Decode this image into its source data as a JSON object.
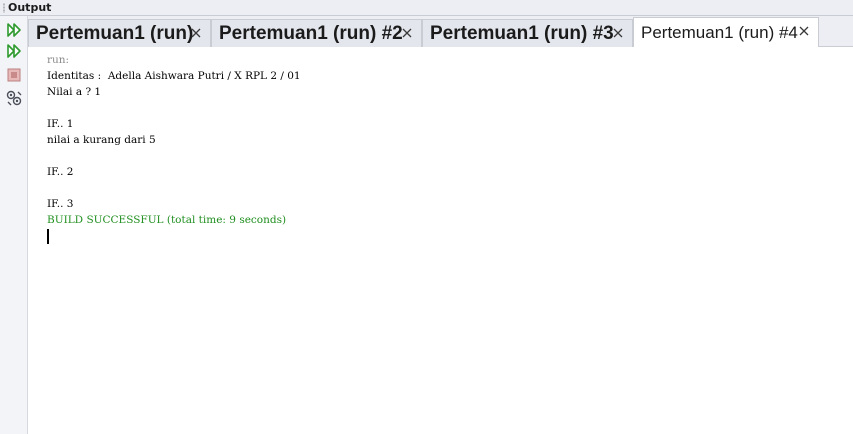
{
  "window": {
    "title": "Output"
  },
  "tabs": [
    {
      "label": "Pertemuan1 (run)",
      "active": false
    },
    {
      "label": "Pertemuan1 (run) #2",
      "active": false
    },
    {
      "label": "Pertemuan1 (run) #3",
      "active": false
    },
    {
      "label": "Pertemuan1 (run) #4",
      "active": true
    }
  ],
  "toolbar": {
    "icons": [
      "rerun-icon",
      "rerun-with-params-icon",
      "stop-icon",
      "settings-icon"
    ]
  },
  "console": {
    "lines": [
      {
        "text": "run:",
        "style": "dim"
      },
      {
        "text": "Identitas :  Adella Aishwara Putri / X RPL 2 / 01",
        "style": "normal"
      },
      {
        "text": "Nilai a ? 1",
        "style": "normal"
      },
      {
        "text": "",
        "style": "normal"
      },
      {
        "text": "IF.. 1",
        "style": "normal"
      },
      {
        "text": "nilai a kurang dari 5",
        "style": "normal"
      },
      {
        "text": "",
        "style": "normal"
      },
      {
        "text": "IF.. 2",
        "style": "normal"
      },
      {
        "text": "",
        "style": "normal"
      },
      {
        "text": "IF.. 3",
        "style": "normal"
      },
      {
        "text": "BUILD SUCCESSFUL (total time: 9 seconds)",
        "style": "success"
      }
    ]
  },
  "colors": {
    "success": "#1f8f1f",
    "dim": "#8a8a8a",
    "rerun_green": "#2e9a2e",
    "stop_red": "#c98a8a"
  }
}
